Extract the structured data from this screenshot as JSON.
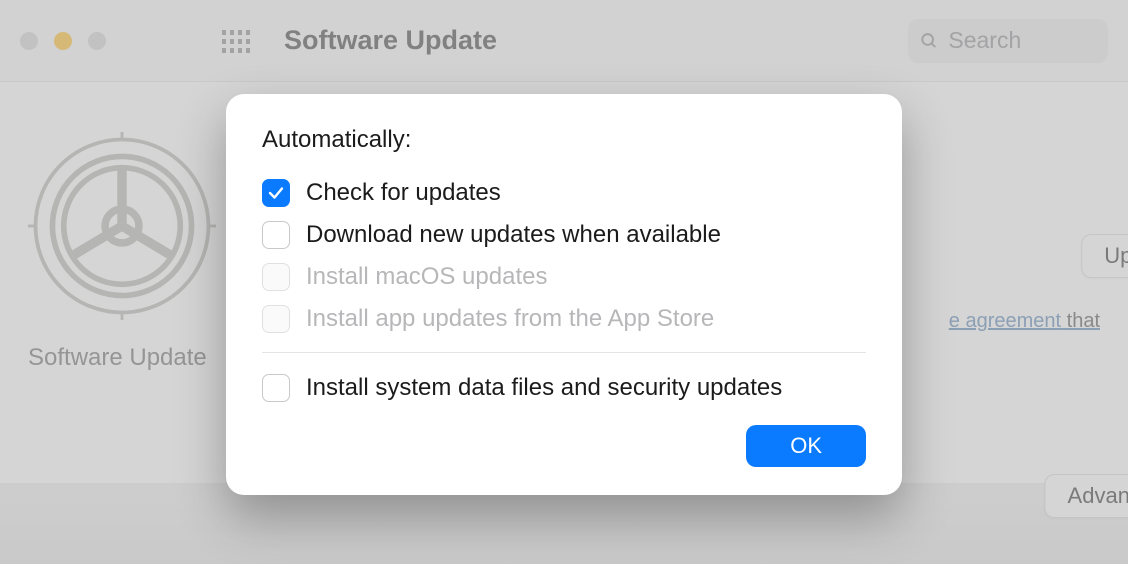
{
  "toolbar": {
    "title": "Software Update",
    "search_placeholder": "Search"
  },
  "main": {
    "pane_label": "Software Update",
    "update_button": "Update",
    "link_fragment": "e agreement",
    "link_tail": " that",
    "advanced_button": "Advanced"
  },
  "sheet": {
    "heading": "Automatically:",
    "options": [
      {
        "label": "Check for updates",
        "checked": true,
        "enabled": true
      },
      {
        "label": "Download new updates when available",
        "checked": false,
        "enabled": true
      },
      {
        "label": "Install macOS updates",
        "checked": false,
        "enabled": false
      },
      {
        "label": "Install app updates from the App Store",
        "checked": false,
        "enabled": false
      }
    ],
    "security_option": {
      "label": "Install system data files and security updates",
      "checked": false,
      "enabled": true
    },
    "ok_button": "OK"
  }
}
